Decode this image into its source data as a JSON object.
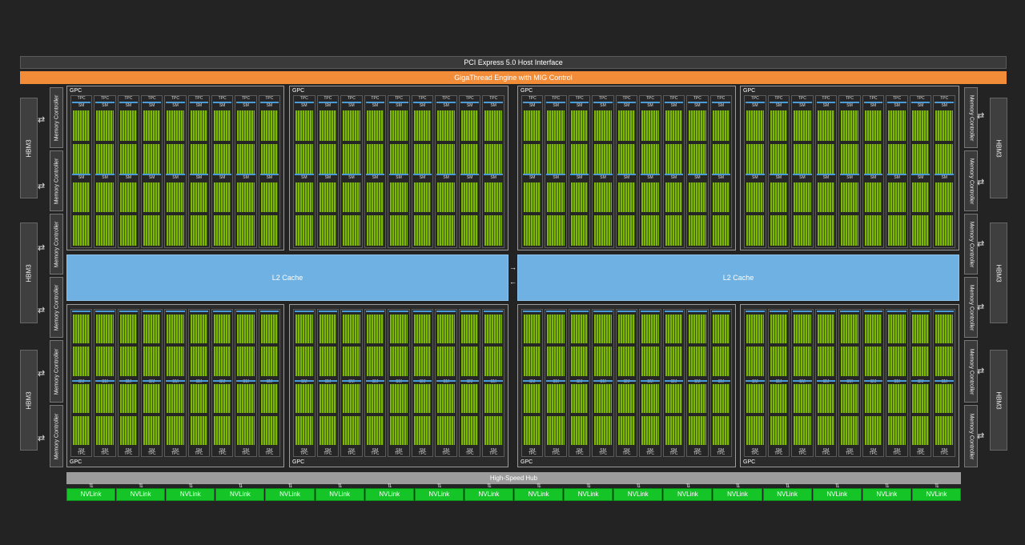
{
  "pcie_label": "PCI Express 5.0 Host Interface",
  "gigathread_label": "GigaThread Engine with MIG Control",
  "gpc_label": "GPC",
  "tpc_label": "TPC",
  "sm_label": "SM",
  "l2_label": "L2 Cache",
  "hub_label": "High-Speed Hub",
  "hbm_label": "HBM3",
  "memory_controller_label": "Memory Controller",
  "nvlink_label": "NVLink",
  "nvlink_count": 18,
  "tpcs_per_gpc": 9,
  "colors": {
    "background": "#232323",
    "gigathread": "#f28c38",
    "l2_cache": "#6fb1e3",
    "nvlink": "#15c528",
    "sm_core": "#7fb800",
    "hub": "#9c9c9c"
  }
}
